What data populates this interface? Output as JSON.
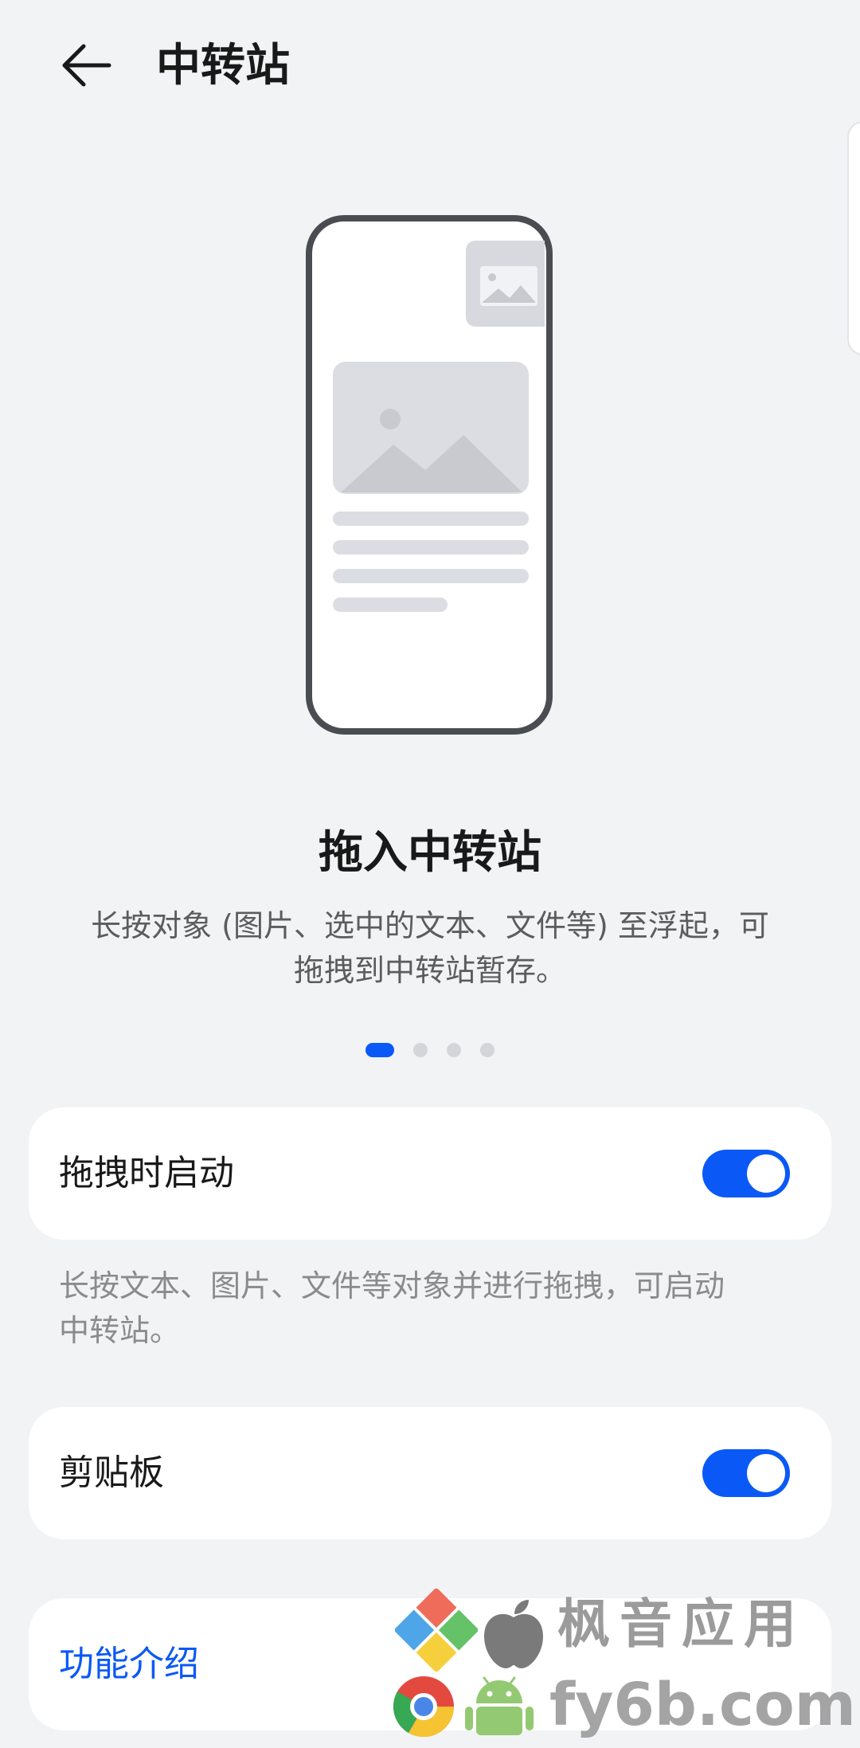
{
  "header": {
    "back_icon": "arrow-left-icon",
    "title": "中转站"
  },
  "feature": {
    "title": "拖入中转站",
    "description_line1": "长按对象 (图片、选中的文本、文件等) 至浮起，可",
    "description_line2": "拖拽到中转站暂存。"
  },
  "pager": {
    "count": 4,
    "active_index": 0
  },
  "settings": {
    "drag_launch": {
      "label": "拖拽时启动",
      "enabled": true,
      "hint_line1": "长按文本、图片、文件等对象并进行拖拽，可启动",
      "hint_line2": "中转站。"
    },
    "clipboard": {
      "label": "剪贴板",
      "enabled": true
    },
    "intro": {
      "label": "功能介绍"
    }
  },
  "watermark": {
    "brand": "枫音应用",
    "domain": "fy6b.com"
  },
  "colors": {
    "background": "#f1f3f5",
    "accent": "#0a59f7",
    "card": "#ffffff",
    "text_primary": "#191919",
    "text_secondary": "#5c5c5e",
    "text_hint": "#8a8b8d"
  }
}
